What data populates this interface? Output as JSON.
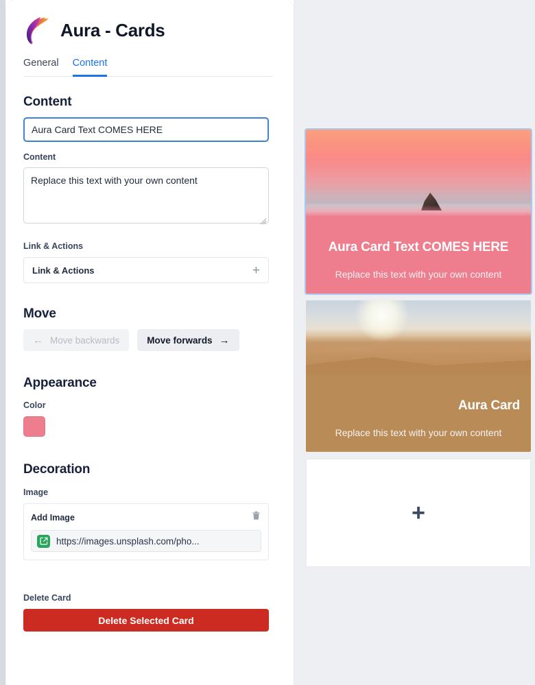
{
  "app": {
    "title": "Aura - Cards",
    "logo_icon": "aura-feather-logo"
  },
  "tabs": [
    {
      "label": "General",
      "active": false
    },
    {
      "label": "Content",
      "active": true
    }
  ],
  "content_section": {
    "heading": "Content",
    "title_input": {
      "value": "Aura Card Text COMES HERE",
      "placeholder": "Aura Card Text COMES HERE"
    },
    "body_label": "Content",
    "body_textarea": {
      "value": "Replace this text with your own content",
      "placeholder": "Replace this text with your own content"
    }
  },
  "link_actions": {
    "label": "Link & Actions",
    "row_label": "Link & Actions",
    "add_icon": "plus-icon"
  },
  "move_section": {
    "heading": "Move",
    "backwards_label": "Move backwards",
    "backwards_icon": "arrow-left-icon",
    "backwards_disabled": true,
    "forwards_label": "Move forwards",
    "forwards_icon": "arrow-right-icon"
  },
  "appearance": {
    "heading": "Appearance",
    "color_label": "Color",
    "color_value": "#ee7d8e"
  },
  "decoration": {
    "heading": "Decoration",
    "image_label": "Image",
    "add_image_label": "Add Image",
    "delete_icon": "trash-icon",
    "link_icon": "external-link-icon",
    "image_url": "https://images.unsplash.com/pho..."
  },
  "delete_section": {
    "label": "Delete Card",
    "button_label": "Delete Selected Card",
    "button_color": "#cc2b22"
  },
  "preview": {
    "cards": [
      {
        "heading": "Aura Card Text COMES HERE",
        "subtitle": "Replace this text with your own content",
        "color": "#ee7d8e",
        "image": "sunset-mountain-photo",
        "selected": true,
        "align": "center"
      },
      {
        "heading": "Aura Card",
        "subtitle": "Replace this text with your own content",
        "color": "#b98b57",
        "image": "desert-dunes-photo",
        "selected": false,
        "align": "right"
      }
    ],
    "add_card": {
      "icon": "plus-icon",
      "label": "+"
    }
  }
}
